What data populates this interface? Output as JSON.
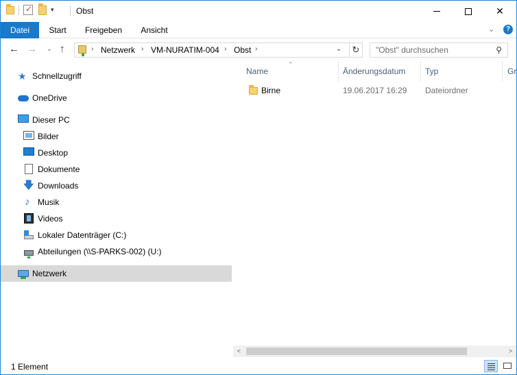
{
  "window": {
    "title": "Obst",
    "controls": {
      "minimize_icon": "minimize-icon",
      "maximize_icon": "maximize-icon",
      "close_icon": "close-icon",
      "close_glyph": "✕"
    }
  },
  "quick_access_toolbar": {
    "icons": [
      "properties-icon",
      "new-folder-icon",
      "customize-dropdown-icon"
    ],
    "dropdown_glyph": "▾"
  },
  "ribbon": {
    "tabs": [
      {
        "label": "Datei",
        "active": true
      },
      {
        "label": "Start"
      },
      {
        "label": "Freigeben"
      },
      {
        "label": "Ansicht"
      }
    ],
    "expand_glyph": "⌄",
    "help_glyph": "?"
  },
  "navigation": {
    "back_glyph": "←",
    "forward_glyph": "→",
    "recent_glyph": "⌄",
    "up_glyph": "↑",
    "breadcrumb": [
      "Netzwerk",
      "VM-NURATIM-004",
      "Obst"
    ],
    "chevron_glyph": "›",
    "dropdown_glyph": "⌄",
    "refresh_glyph": "↻",
    "search_placeholder": "\"Obst\" durchsuchen",
    "search_glyph": "⚲"
  },
  "nav_pane": {
    "items": [
      {
        "label": "Schnellzugriff",
        "icon": "star-icon",
        "glyph": "★"
      },
      {
        "label": "OneDrive",
        "icon": "cloud-icon"
      },
      {
        "label": "Dieser PC",
        "icon": "computer-icon"
      },
      {
        "label": "Bilder",
        "icon": "pictures-icon"
      },
      {
        "label": "Desktop",
        "icon": "desktop-icon"
      },
      {
        "label": "Dokumente",
        "icon": "documents-icon"
      },
      {
        "label": "Downloads",
        "icon": "download-icon",
        "glyph": "🡇"
      },
      {
        "label": "Musik",
        "icon": "music-icon",
        "glyph": "♪"
      },
      {
        "label": "Videos",
        "icon": "videos-icon"
      },
      {
        "label": "Lokaler Datenträger (C:)",
        "icon": "local-drive-icon"
      },
      {
        "label": "Abteilungen (\\\\S-PARKS-002) (U:)",
        "icon": "network-drive-icon"
      },
      {
        "label": "Netzwerk",
        "icon": "network-icon",
        "selected": true
      }
    ]
  },
  "file_list": {
    "columns": [
      "Name",
      "Änderungsdatum",
      "Typ",
      "Gr"
    ],
    "sort_glyph": "⌃",
    "rows": [
      {
        "name": "Birne",
        "modified": "19.06.2017 16:29",
        "type": "Dateiordner",
        "icon": "folder-icon"
      }
    ]
  },
  "scrollbar": {
    "left_glyph": "<",
    "right_glyph": ">"
  },
  "status_bar": {
    "item_count": "1 Element",
    "views": [
      "details-view-icon",
      "large-icons-view-icon"
    ]
  }
}
